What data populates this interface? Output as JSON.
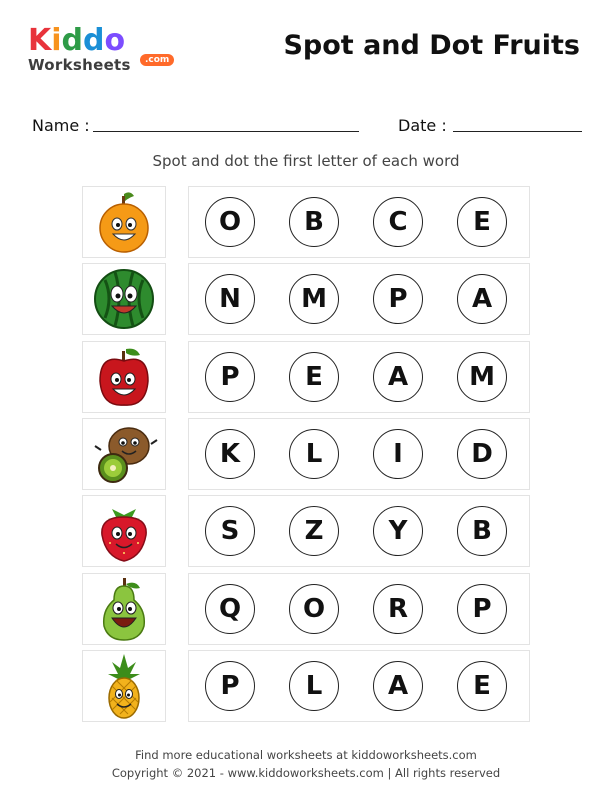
{
  "logo": {
    "brand": "Kiddo",
    "sub": "Worksheets",
    "tld": ".com",
    "colors": [
      "#e8333b",
      "#f7931e",
      "#2e9b47",
      "#1a8fd6",
      "#7c4dff"
    ]
  },
  "title": "Spot and Dot Fruits",
  "fields": {
    "name_label": "Name :",
    "date_label": "Date :"
  },
  "instruction": "Spot and dot the first letter of each word",
  "rows": [
    {
      "fruit": "orange-icon",
      "letters": [
        "O",
        "B",
        "C",
        "E"
      ]
    },
    {
      "fruit": "watermelon-icon",
      "letters": [
        "N",
        "M",
        "P",
        "A"
      ]
    },
    {
      "fruit": "apple-icon",
      "letters": [
        "P",
        "E",
        "A",
        "M"
      ]
    },
    {
      "fruit": "kiwi-icon",
      "letters": [
        "K",
        "L",
        "I",
        "D"
      ]
    },
    {
      "fruit": "strawberry-icon",
      "letters": [
        "S",
        "Z",
        "Y",
        "B"
      ]
    },
    {
      "fruit": "pear-icon",
      "letters": [
        "Q",
        "O",
        "R",
        "P"
      ]
    },
    {
      "fruit": "pineapple-icon",
      "letters": [
        "P",
        "L",
        "A",
        "E"
      ]
    }
  ],
  "footer": {
    "line1": "Find more educational worksheets at kiddoworksheets.com",
    "line2": "Copyright © 2021 - www.kiddoworksheets.com  |  All rights reserved"
  }
}
